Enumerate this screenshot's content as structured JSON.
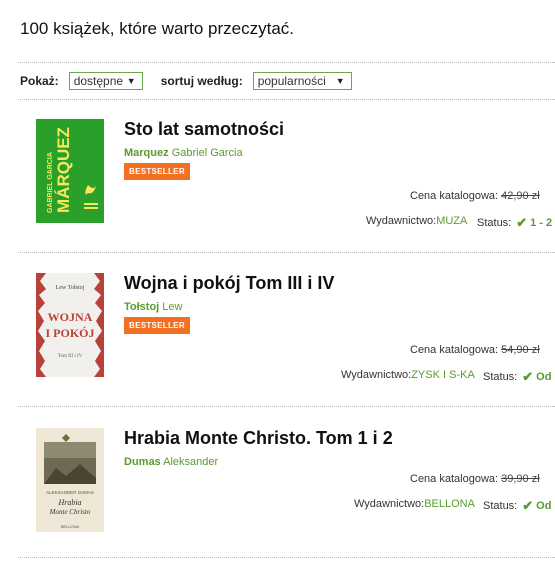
{
  "page": {
    "title": "100 książek, które warto przeczytać."
  },
  "filters": {
    "show_label": "Pokaż:",
    "show_value": "dostępne",
    "sort_label": "sortuj według:",
    "sort_value": "popularności"
  },
  "books": [
    {
      "title": "Sto lat samotności",
      "author_surname": "Marquez",
      "author_firstname": "Gabriel Garcia",
      "badge": "BESTSELLER",
      "price_label": "Cena katalogowa:",
      "price": "42,90 zł",
      "publisher_label": "Wydawnictwo:",
      "publisher": "MUZA",
      "status_label": "Status:",
      "status": "1 - 2",
      "cover": {
        "author": "GABRIEL GARCIA",
        "name": "MÁRQUEZ",
        "bg": "#2aa02a"
      }
    },
    {
      "title": "Wojna i pokój Tom III i IV",
      "author_surname": "Tołstoj",
      "author_firstname": "Lew",
      "badge": "BESTSELLER",
      "price_label": "Cena katalogowa:",
      "price": "54,90 zł",
      "publisher_label": "Wydawnictwo:",
      "publisher": "ZYSK I S-KA",
      "status_label": "Status:",
      "status": "Od",
      "cover": {
        "author": "Lew Tołstoj",
        "name1": "WOJNA",
        "name2": "I POKÓJ",
        "sub": "Tom III i IV",
        "bg": "#f2f0ec"
      }
    },
    {
      "title": "Hrabia Monte Christo. Tom 1 i 2",
      "author_surname": "Dumas",
      "author_firstname": "Aleksander",
      "badge": "",
      "price_label": "Cena katalogowa:",
      "price": "39,90 zł",
      "publisher_label": "Wydawnictwo:",
      "publisher": "BELLONA",
      "status_label": "Status:",
      "status": "Od",
      "cover": {
        "author": "ALEKSANDER DUMAS",
        "name1": "Hrabia",
        "name2": "Monte Christo",
        "pub": "BELLONA",
        "bg": "#efe7d6"
      }
    }
  ],
  "colors": {
    "accent": "#5a9b2f",
    "badge": "#f36f21",
    "select_border": "#6aa84f"
  }
}
